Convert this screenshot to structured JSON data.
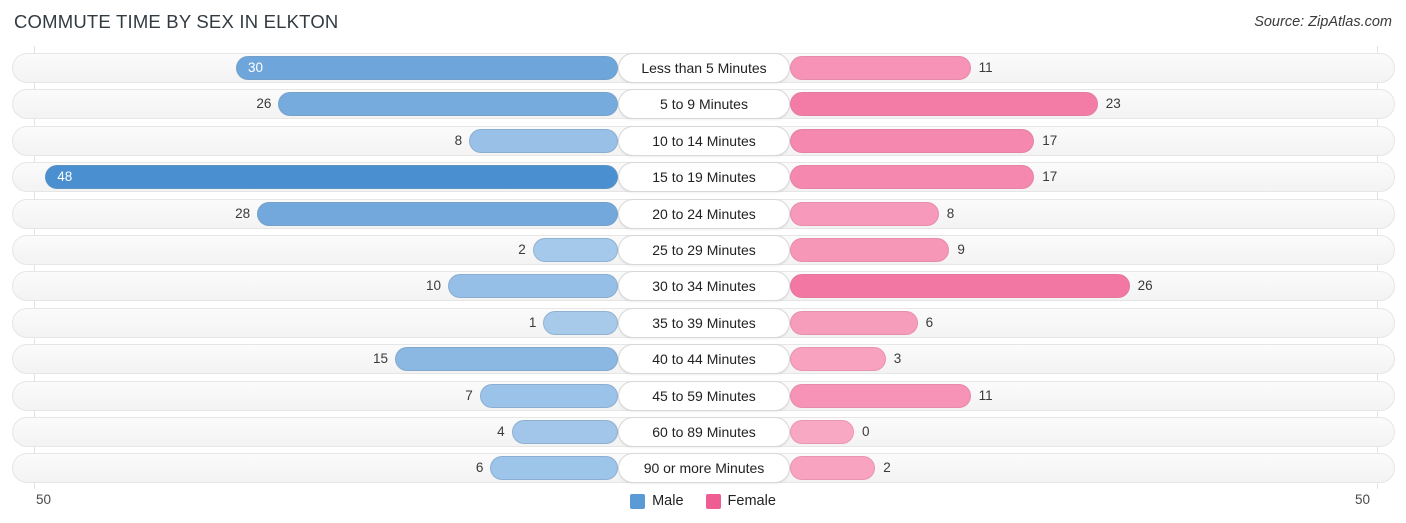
{
  "header": {
    "title": "COMMUTE TIME BY SEX IN ELKTON",
    "source": "Source: ZipAtlas.com"
  },
  "legend": {
    "items": [
      {
        "label": "Male",
        "color": "#5b9bd5"
      },
      {
        "label": "Female",
        "color": "#ee5e92"
      }
    ]
  },
  "axis": {
    "left_label": "50",
    "right_label": "50"
  },
  "chart_data": {
    "type": "bar",
    "orientation": "horizontal-diverging",
    "title": "Commute Time by Sex in Elkton",
    "xlabel": "",
    "ylabel": "",
    "xlim": [
      -50,
      50
    ],
    "grid": true,
    "legend_position": "bottom-center",
    "categories": [
      "Less than 5 Minutes",
      "5 to 9 Minutes",
      "10 to 14 Minutes",
      "15 to 19 Minutes",
      "20 to 24 Minutes",
      "25 to 29 Minutes",
      "30 to 34 Minutes",
      "35 to 39 Minutes",
      "40 to 44 Minutes",
      "45 to 59 Minutes",
      "60 to 89 Minutes",
      "90 or more Minutes"
    ],
    "series": [
      {
        "name": "Male",
        "color": "#5b9bd5",
        "values": [
          30,
          26,
          8,
          48,
          28,
          2,
          10,
          1,
          15,
          7,
          4,
          6
        ]
      },
      {
        "name": "Female",
        "color": "#ee5e92",
        "values": [
          11,
          23,
          17,
          17,
          8,
          9,
          26,
          6,
          3,
          11,
          0,
          2
        ]
      }
    ]
  },
  "rows": [
    {
      "category": "Less than 5 Minutes",
      "male": "30",
      "female": "11"
    },
    {
      "category": "5 to 9 Minutes",
      "male": "26",
      "female": "23"
    },
    {
      "category": "10 to 14 Minutes",
      "male": "8",
      "female": "17"
    },
    {
      "category": "15 to 19 Minutes",
      "male": "48",
      "female": "17"
    },
    {
      "category": "20 to 24 Minutes",
      "male": "28",
      "female": "8"
    },
    {
      "category": "25 to 29 Minutes",
      "male": "2",
      "female": "9"
    },
    {
      "category": "30 to 34 Minutes",
      "male": "10",
      "female": "26"
    },
    {
      "category": "35 to 39 Minutes",
      "male": "1",
      "female": "6"
    },
    {
      "category": "40 to 44 Minutes",
      "male": "15",
      "female": "3"
    },
    {
      "category": "45 to 59 Minutes",
      "male": "7",
      "female": "11"
    },
    {
      "category": "60 to 89 Minutes",
      "male": "4",
      "female": "0"
    },
    {
      "category": "90 or more Minutes",
      "male": "6",
      "female": "2"
    }
  ]
}
